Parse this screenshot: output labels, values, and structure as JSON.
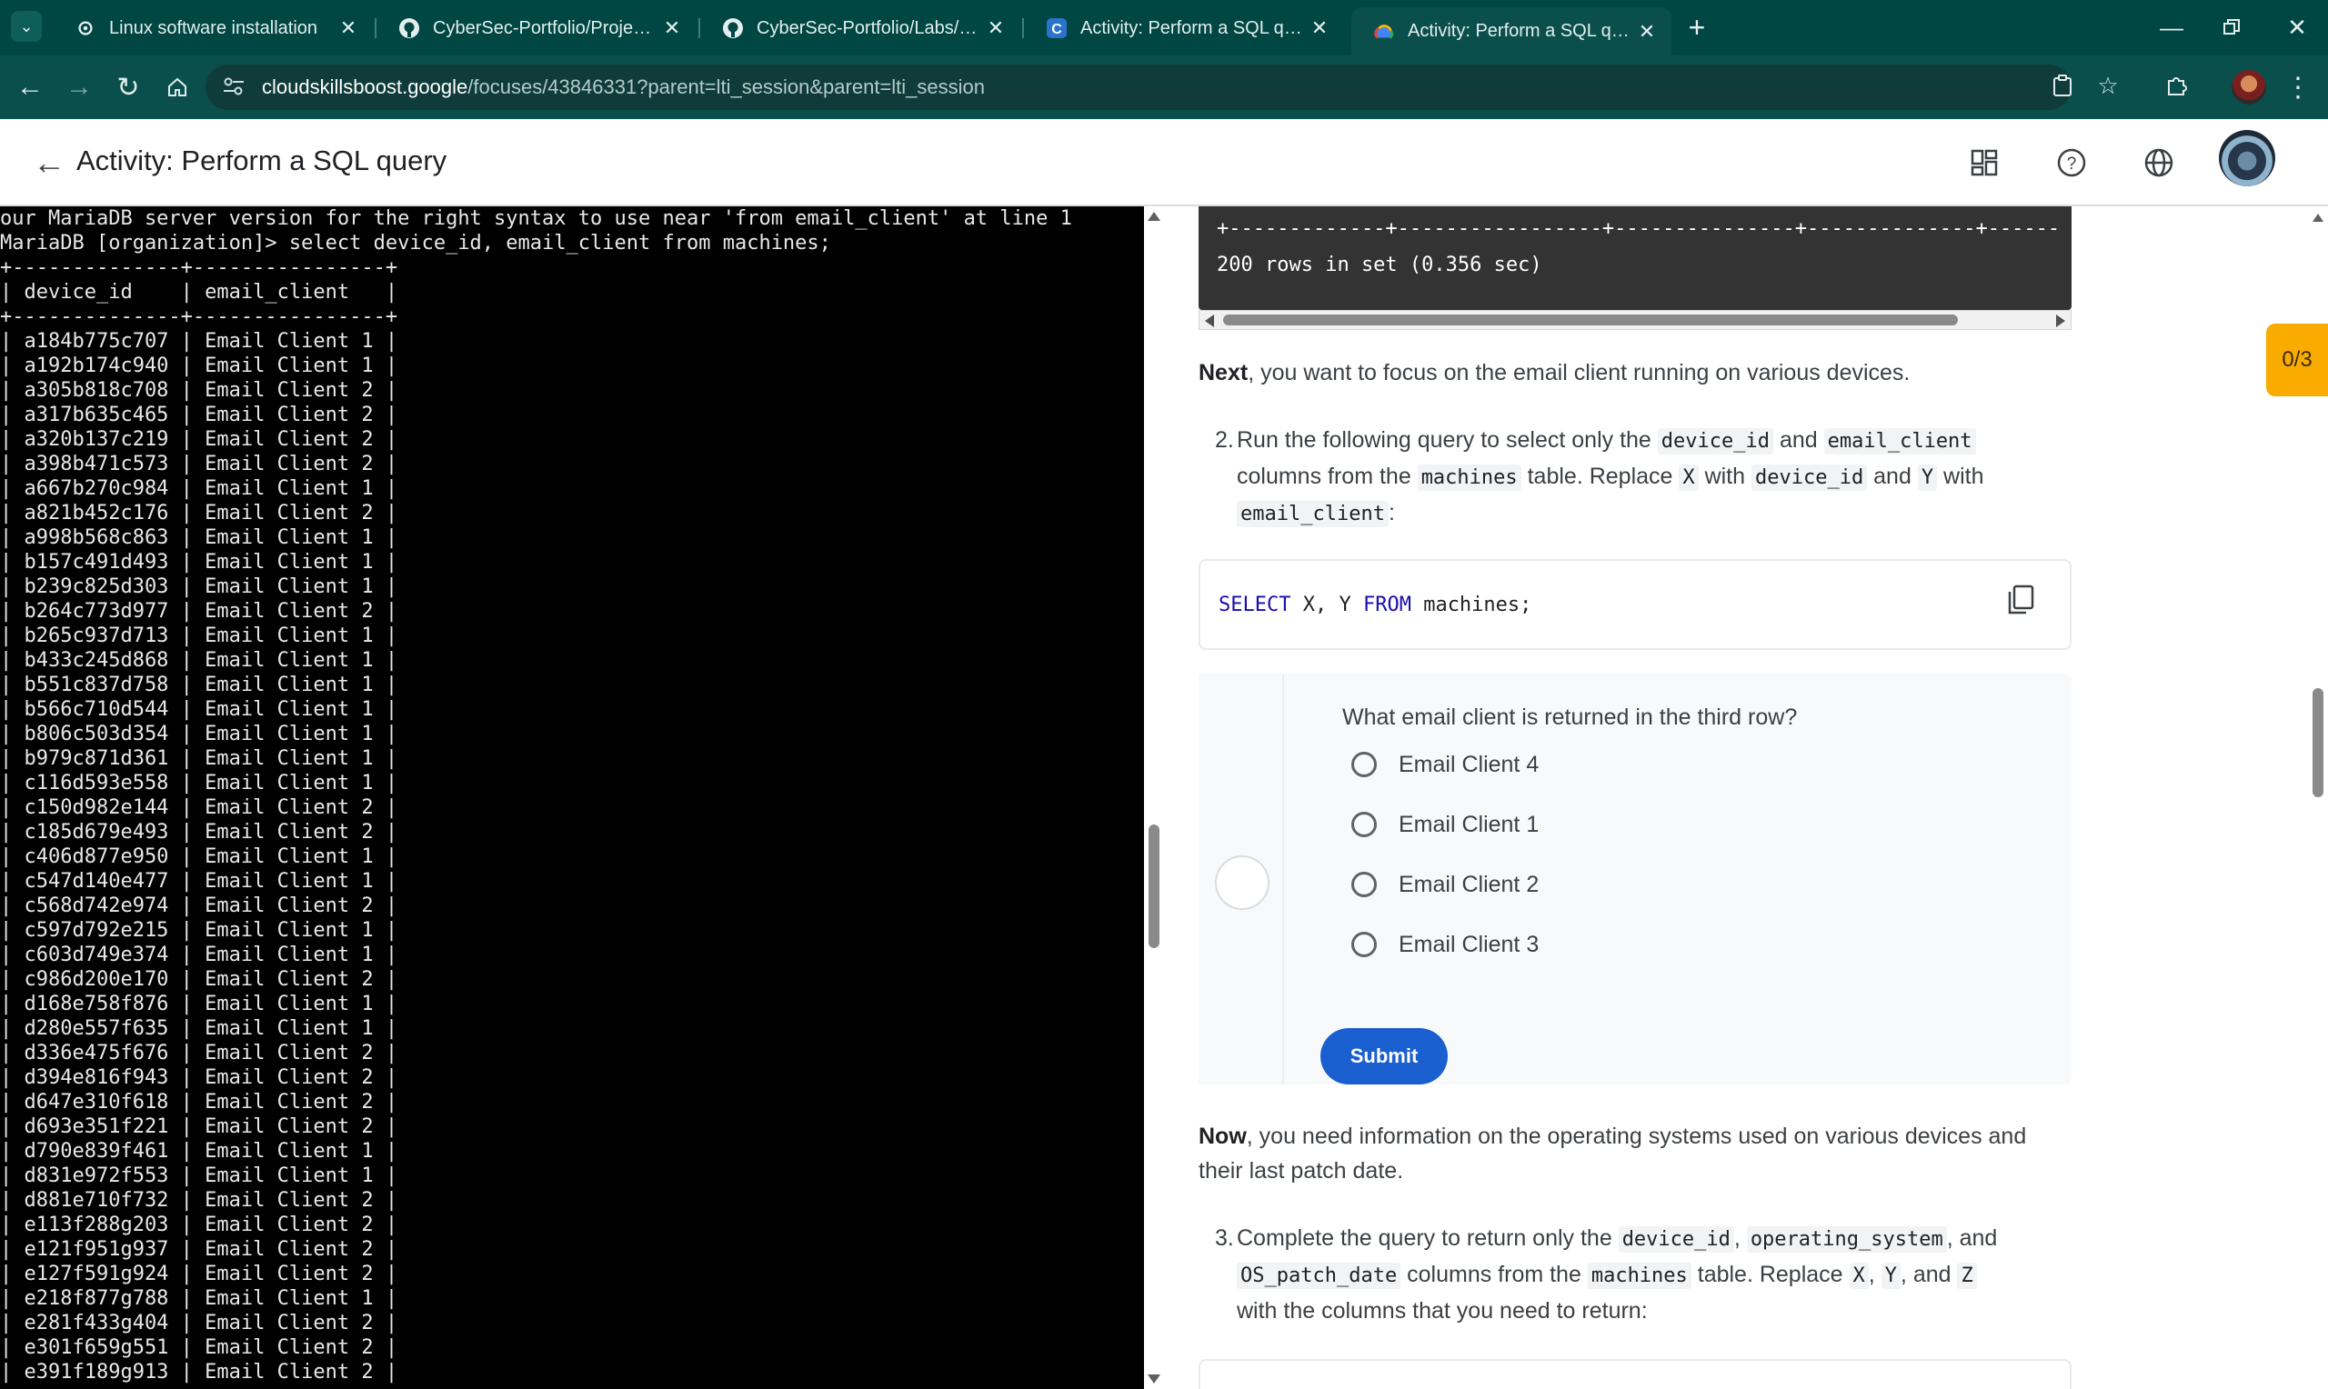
{
  "browser": {
    "tabs": [
      {
        "title": "Linux software installation",
        "icon": "cog-favicon"
      },
      {
        "title": "CyberSec-Portfolio/Projects/Go",
        "icon": "github-icon"
      },
      {
        "title": "CyberSec-Portfolio/Labs/Qwikla",
        "icon": "github-icon"
      },
      {
        "title": "Activity: Perform a SQL query | C",
        "icon": "coursera-icon"
      },
      {
        "title": "Activity: Perform a SQL query | C",
        "icon": "google-cloud-icon"
      }
    ],
    "active_tab_index": 4,
    "url_domain": "cloudskillsboost.google",
    "url_path": "/focuses/43846331?parent=lti_session&parent=lti_session"
  },
  "header": {
    "title": "Activity: Perform a SQL query"
  },
  "terminal": {
    "lines": [
      "our MariaDB server version for the right syntax to use near 'from email_client' at line 1",
      "MariaDB [organization]> select device_id, email_client from machines;",
      "+--------------+----------------+",
      "| device_id    | email_client   |",
      "+--------------+----------------+",
      "| a184b775c707 | Email Client 1 |",
      "| a192b174c940 | Email Client 1 |",
      "| a305b818c708 | Email Client 2 |",
      "| a317b635c465 | Email Client 2 |",
      "| a320b137c219 | Email Client 2 |",
      "| a398b471c573 | Email Client 2 |",
      "| a667b270c984 | Email Client 1 |",
      "| a821b452c176 | Email Client 2 |",
      "| a998b568c863 | Email Client 1 |",
      "| b157c491d493 | Email Client 1 |",
      "| b239c825d303 | Email Client 1 |",
      "| b264c773d977 | Email Client 2 |",
      "| b265c937d713 | Email Client 1 |",
      "| b433c245d868 | Email Client 1 |",
      "| b551c837d758 | Email Client 1 |",
      "| b566c710d544 | Email Client 1 |",
      "| b806c503d354 | Email Client 1 |",
      "| b979c871d361 | Email Client 1 |",
      "| c116d593e558 | Email Client 1 |",
      "| c150d982e144 | Email Client 2 |",
      "| c185d679e493 | Email Client 2 |",
      "| c406d877e950 | Email Client 1 |",
      "| c547d140e477 | Email Client 1 |",
      "| c568d742e974 | Email Client 2 |",
      "| c597d792e215 | Email Client 1 |",
      "| c603d749e374 | Email Client 1 |",
      "| c986d200e170 | Email Client 2 |",
      "| d168e758f876 | Email Client 1 |",
      "| d280e557f635 | Email Client 1 |",
      "| d336e475f676 | Email Client 2 |",
      "| d394e816f943 | Email Client 2 |",
      "| d647e310f618 | Email Client 2 |",
      "| d693e351f221 | Email Client 2 |",
      "| d790e839f461 | Email Client 1 |",
      "| d831e972f553 | Email Client 1 |",
      "| d881e710f732 | Email Client 2 |",
      "| e113f288g203 | Email Client 2 |",
      "| e121f951g937 | Email Client 2 |",
      "| e127f591g924 | Email Client 2 |",
      "| e218f877g788 | Email Client 1 |",
      "| e281f433g404 | Email Client 2 |",
      "| e301f659g551 | Email Client 2 |",
      "| e391f189g913 | Email Client 2 |"
    ]
  },
  "content": {
    "prev_output_border": "+-------------+-----------------+---------------+--------------+------",
    "prev_output_rows": "200 rows in set (0.356 sec)",
    "next_para_bold": "Next",
    "next_para_rest": ", you want to focus on the email client running on various devices.",
    "step2": {
      "number": "2.",
      "t1": "Run the following query to select only the ",
      "c1": "device_id",
      "t2": " and ",
      "c2": "email_client",
      "t3": " columns from the ",
      "c3": "machines",
      "t4": " table. Replace ",
      "c4": "X",
      "t5": " with ",
      "c5": "device_id",
      "t6": " and ",
      "c6": "Y",
      "t7": " with ",
      "c7": "email_client",
      "t8": ":"
    },
    "query2": {
      "kw1": "SELECT",
      "mid": " X, Y ",
      "kw2": "FROM",
      "end": " machines;"
    },
    "quiz": {
      "question": "What email client is returned in the third row?",
      "options": [
        "Email Client 4",
        "Email Client 1",
        "Email Client 2",
        "Email Client 3"
      ],
      "submit_label": "Submit"
    },
    "now_para_bold": "Now",
    "now_para_rest": ", you need information on the operating systems used on various devices and their last patch date.",
    "step3": {
      "number": "3.",
      "t1": "Complete the query to return only the ",
      "c1": "device_id",
      "t2": ", ",
      "c2": "operating_system",
      "t3": ", and ",
      "c3": "OS_patch_date",
      "t4": " columns from the ",
      "c4": "machines",
      "t5": " table. Replace ",
      "c5": "X",
      "t6": ", ",
      "c6": "Y",
      "t7": ", and ",
      "c7": "Z",
      "t8": " with the columns that you need to return:"
    },
    "score": "0/3"
  },
  "colors": {
    "tabstrip": "#004643",
    "toolbar": "#0b4f4c",
    "submit": "#1a5fd0",
    "score_badge": "#f9ab00"
  }
}
